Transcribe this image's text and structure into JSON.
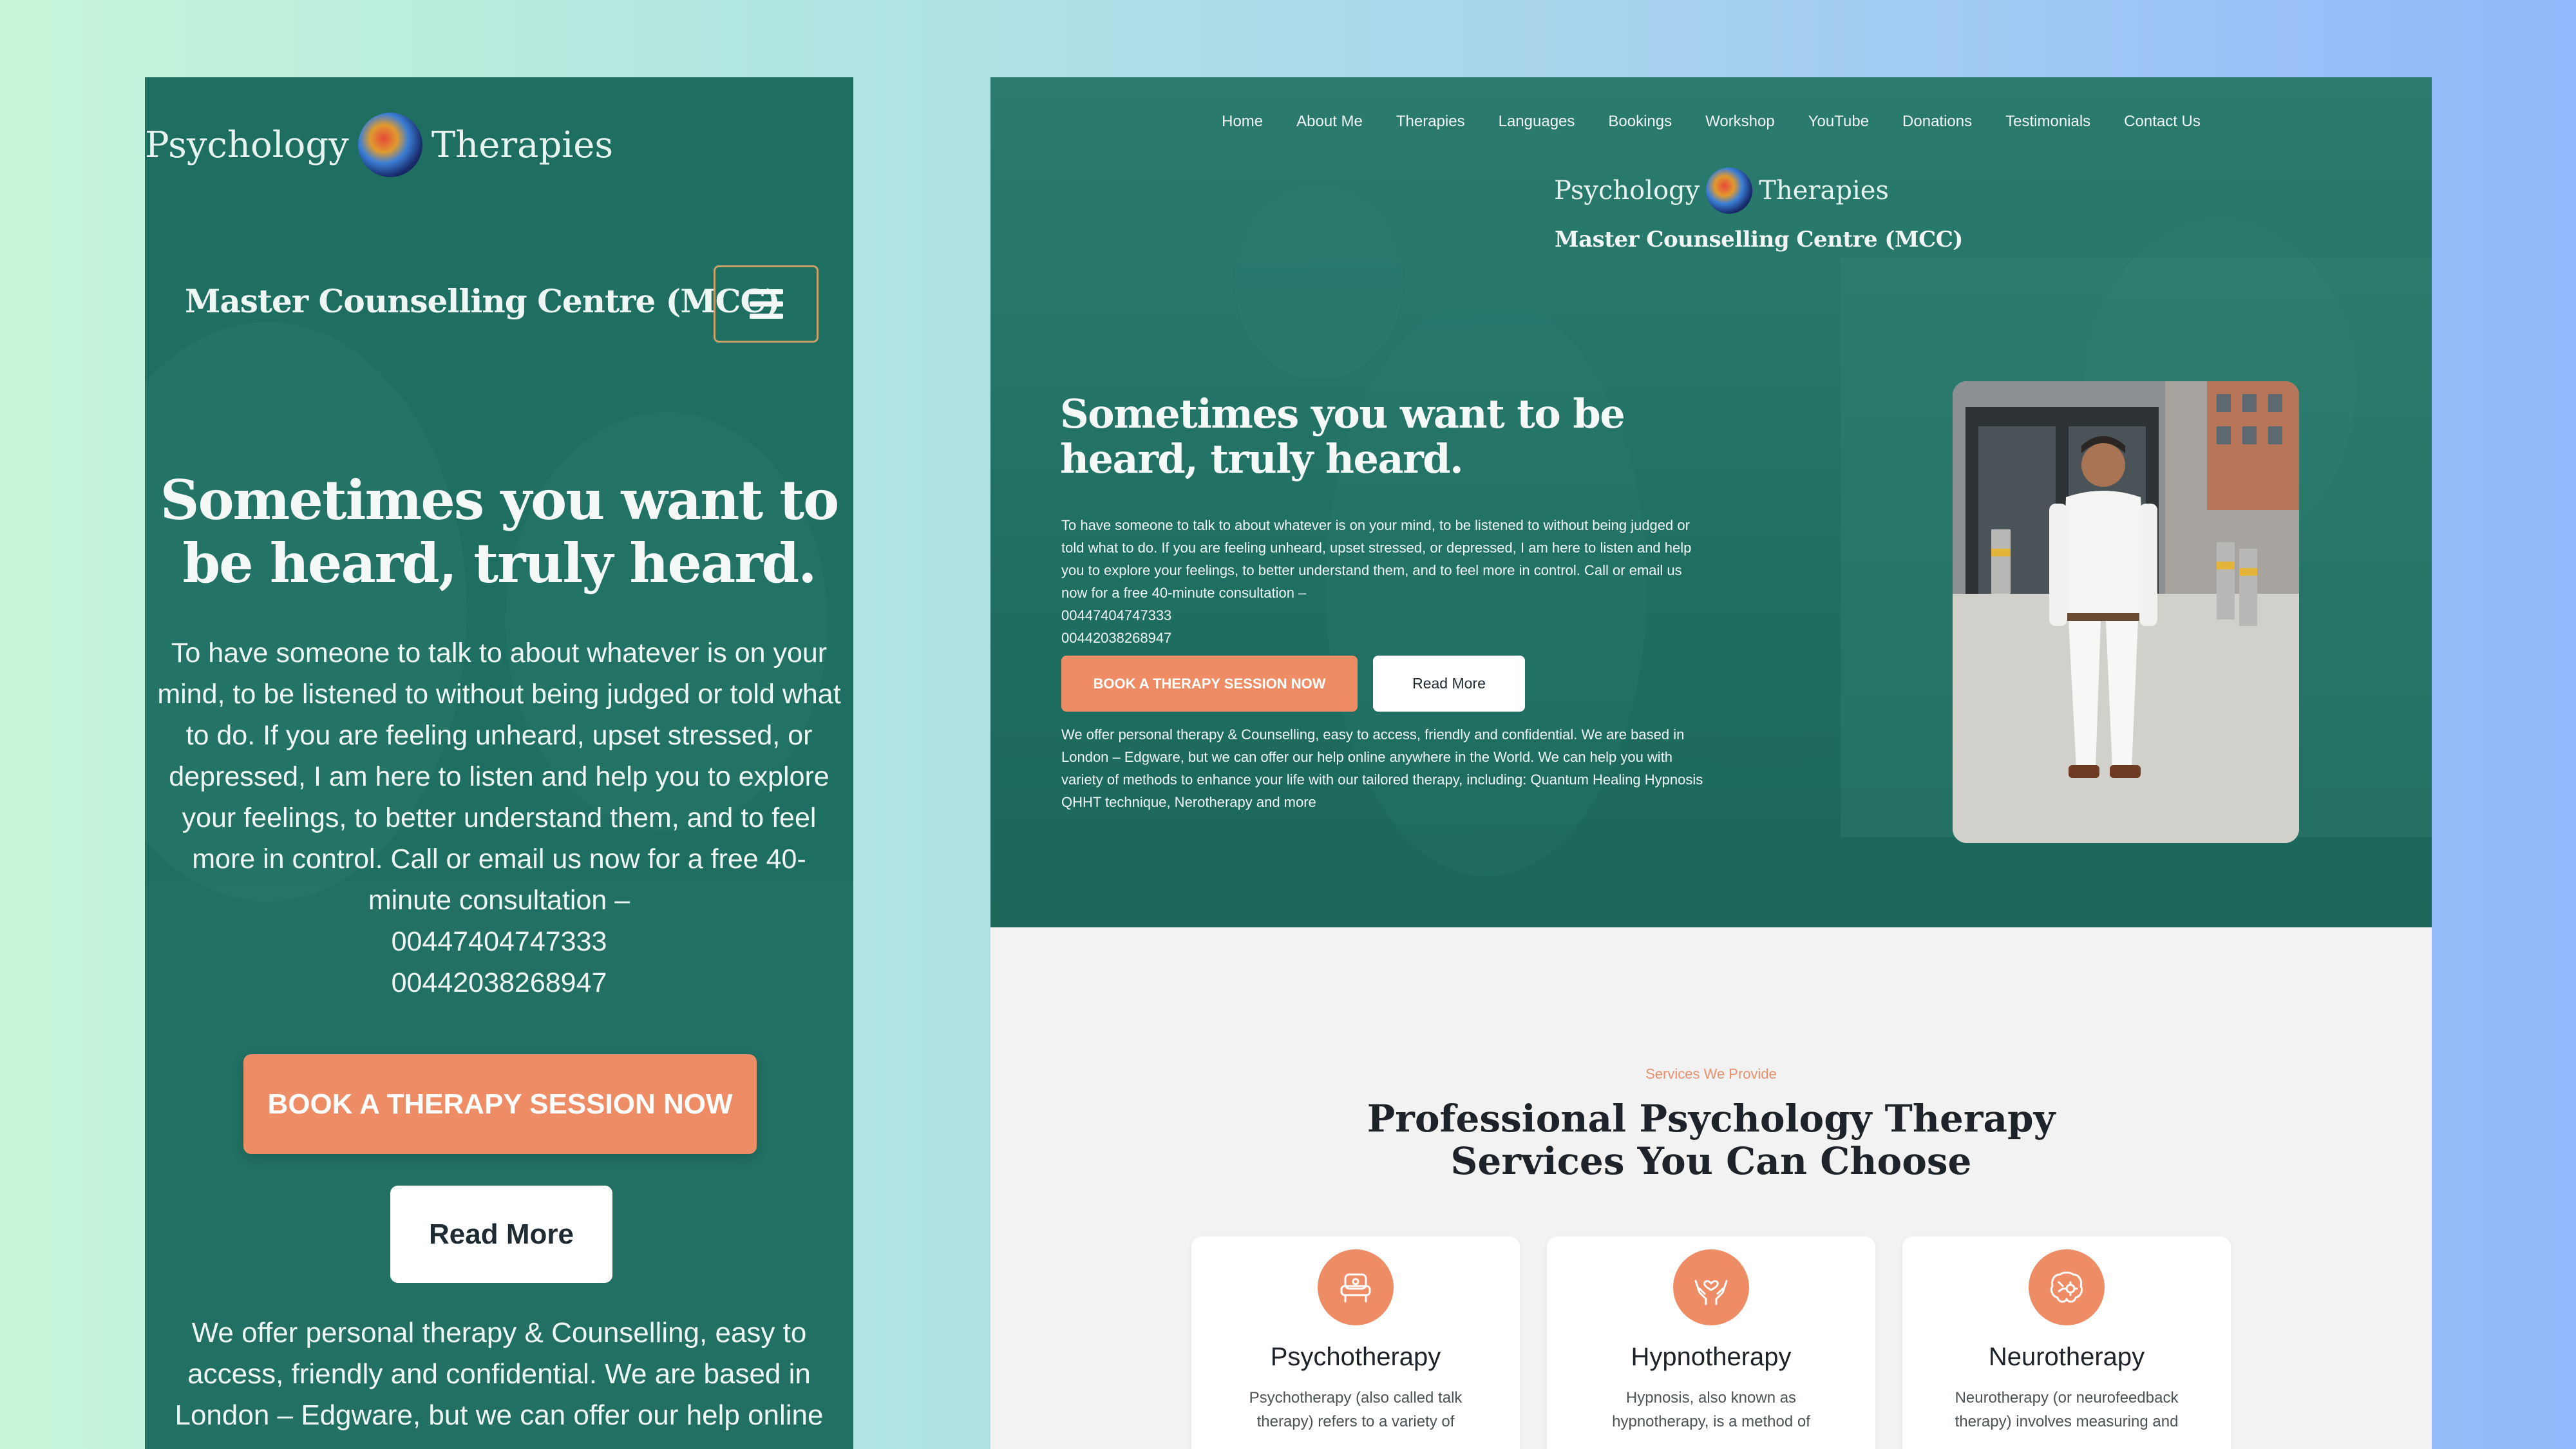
{
  "brand": {
    "logo_left": "Psychology",
    "logo_right": "Therapies",
    "centre_name": "Master Counselling Centre (MCC)"
  },
  "nav": {
    "items": [
      "Home",
      "About Me",
      "Therapies",
      "Languages",
      "Bookings",
      "Workshop",
      "YouTube",
      "Donations",
      "Testimonials",
      "Contact Us"
    ]
  },
  "hero": {
    "title": "Sometimes you want to be heard, truly heard.",
    "body": "To have someone to talk to about whatever is on your mind, to be listened to without being judged or told what to do. If you are feeling unheard, upset stressed, or depressed, I am here to listen and help you to explore your feelings, to better understand them, and to feel more in control. Call or email us now for a free 40-minute consultation –",
    "phone_1": "00447404747333",
    "phone_2": "00442038268947",
    "book_label": "BOOK A THERAPY SESSION NOW",
    "read_label": "Read More",
    "about_text": "We offer personal therapy & Counselling, easy to access, friendly and confidential.   We are based in London – Edgware, but we can offer our help online anywhere in the World. We can help you with variety of methods to enhance your life with our tailored therapy, including: Quantum Healing Hypnosis QHHT technique, Nerotherapy and more",
    "about_text_mobile": "We offer personal therapy & Counselling, easy to access, friendly and confidential.   We are based in London – Edgware, but we can offer our help online"
  },
  "services": {
    "eyebrow": "Services We Provide",
    "title": "Professional Psychology Therapy Services You Can Choose",
    "cards": [
      {
        "title": "Psychotherapy",
        "desc": "Psychotherapy (also called talk therapy) refers to a variety of",
        "icon": "therapy-chair-icon"
      },
      {
        "title": "Hypnotherapy",
        "desc": "Hypnosis, also known as hypnotherapy, is a method of",
        "icon": "caring-hands-icon"
      },
      {
        "title": "Neurotherapy",
        "desc": "Neurotherapy (or neurofeedback therapy) involves measuring and",
        "icon": "brain-gear-icon"
      }
    ]
  },
  "colors": {
    "hero_green": "#1f6e62",
    "accent_orange": "#ee8c66",
    "background_gradient_left": "#c6f5d8",
    "background_gradient_right": "#93b8fb"
  }
}
